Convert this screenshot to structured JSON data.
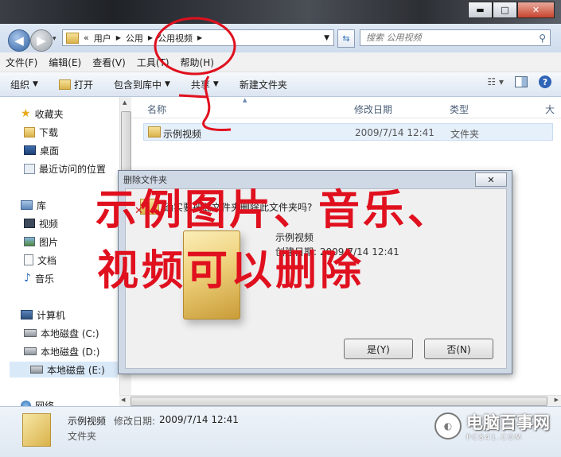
{
  "window": {
    "minimize": "▬",
    "maximize": "□",
    "close": "✕"
  },
  "address": {
    "prefix": "«",
    "crumbs": [
      "用户",
      "公用",
      "公用视频"
    ],
    "search_placeholder": "搜索 公用视频"
  },
  "menu": [
    "文件(F)",
    "编辑(E)",
    "查看(V)",
    "工具(T)",
    "帮助(H)"
  ],
  "toolbar": {
    "organize": "组织",
    "open": "打开",
    "include_library": "包含到库中",
    "share": "共享",
    "new_folder": "新建文件夹"
  },
  "sidebar": {
    "favorites": "收藏夹",
    "fav_items": [
      "下载",
      "桌面",
      "最近访问的位置"
    ],
    "libraries": "库",
    "lib_items": [
      "视频",
      "图片",
      "文档",
      "音乐"
    ],
    "computer": "计算机",
    "drives": [
      "本地磁盘 (C:)",
      "本地磁盘 (D:)",
      "本地磁盘 (E:)"
    ],
    "network": "网络"
  },
  "columns": {
    "name": "名称",
    "date": "修改日期",
    "type": "类型",
    "size": "大"
  },
  "files": [
    {
      "name": "示例视频",
      "date": "2009/7/14 12:41",
      "type": "文件夹"
    }
  ],
  "details": {
    "name": "示例视频",
    "date_label": "修改日期:",
    "date": "2009/7/14 12:41",
    "type": "文件夹"
  },
  "dialog": {
    "title": "删除文件夹",
    "question": "确实要把此文件夹删除此文件夹吗?",
    "item_name": "示例视频",
    "item_created": "创建日期: 2009/7/14 12:41",
    "yes": "是(Y)",
    "no": "否(N)"
  },
  "annotation": {
    "line1": "示例图片、音乐、",
    "line2": "视频可以删除",
    "color": "#e0101e"
  },
  "watermark": {
    "text": "电脑百事网",
    "sub": "PC841.COM"
  }
}
